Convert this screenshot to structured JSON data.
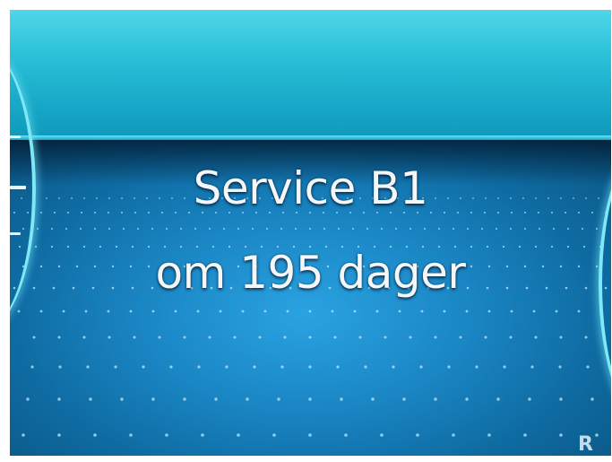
{
  "service_message": {
    "line1": "Service B1",
    "line2": "om 195 dager"
  },
  "status": {
    "gear": "R"
  },
  "colors": {
    "header_band": "#2bc1d8",
    "background": "#1a86c4",
    "text": "#f4f6f8",
    "gauge_arc": "#7fe8f7"
  }
}
